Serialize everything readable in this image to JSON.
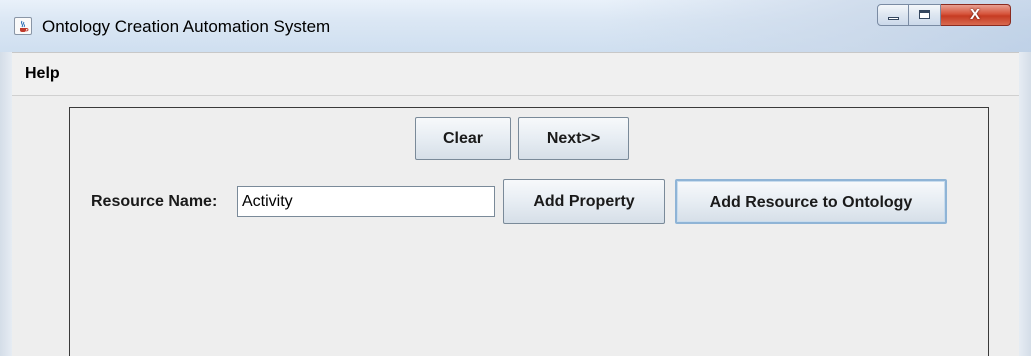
{
  "window": {
    "title": "Ontology Creation Automation System",
    "close_glyph": "X",
    "icons": [
      "java-cup-icon",
      "minimize-icon",
      "maximize-icon",
      "close-icon"
    ]
  },
  "menubar": {
    "items": [
      {
        "label": "Help"
      }
    ]
  },
  "form": {
    "clear_label": "Clear",
    "next_label": "Next>>",
    "resource_name_label": "Resource Name:",
    "resource_name_value": "Activity",
    "add_property_label": "Add Property",
    "add_resource_label": "Add Resource to Ontology"
  },
  "colors": {
    "close_button": "#c63b22",
    "focus_border": "#8fb4d6",
    "panel_border": "#3a3a3a"
  }
}
